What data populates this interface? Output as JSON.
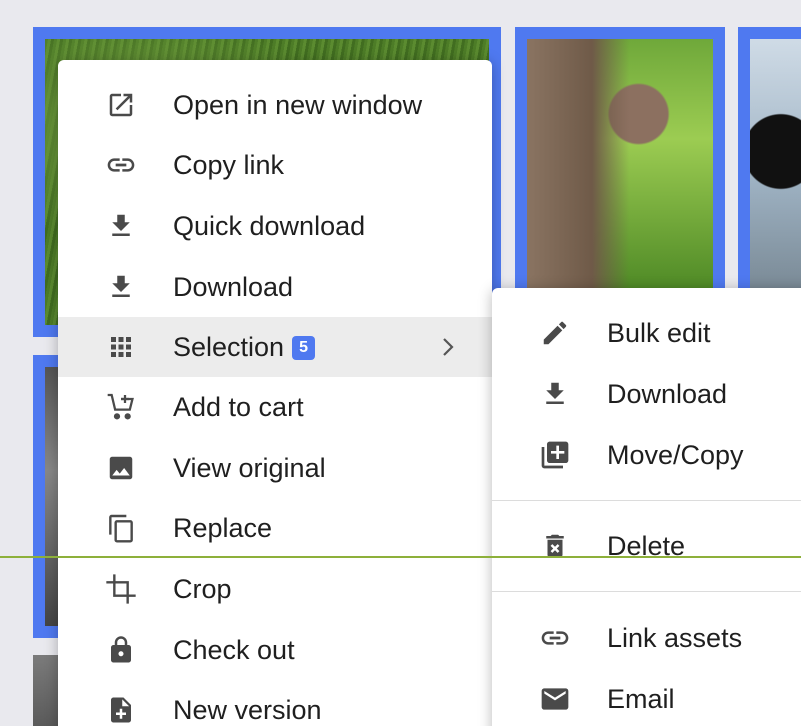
{
  "colors": {
    "selection_accent": "#4f79f0",
    "menu_bg": "#ffffff",
    "highlight_bg": "#ececec",
    "icon": "#4a4a4a",
    "guide_line": "#8db03a"
  },
  "context_menu": {
    "items": [
      {
        "label": "Open in new window",
        "icon": "open-in-new-icon"
      },
      {
        "label": "Copy link",
        "icon": "link-icon"
      },
      {
        "label": "Quick download",
        "icon": "download-icon"
      },
      {
        "label": "Download",
        "icon": "download-icon"
      },
      {
        "label": "Selection",
        "icon": "grid-icon",
        "badge": "5",
        "submenu": true,
        "highlighted": true
      },
      {
        "label": "Add to cart",
        "icon": "add-cart-icon"
      },
      {
        "label": "View original",
        "icon": "image-icon"
      },
      {
        "label": "Replace",
        "icon": "copy-icon"
      },
      {
        "label": "Crop",
        "icon": "crop-icon"
      },
      {
        "label": "Check out",
        "icon": "lock-icon"
      },
      {
        "label": "New version",
        "icon": "new-file-icon"
      }
    ]
  },
  "selection_submenu": {
    "items": [
      {
        "label": "Bulk edit",
        "icon": "pencil-icon"
      },
      {
        "label": "Download",
        "icon": "download-icon"
      },
      {
        "label": "Move/Copy",
        "icon": "library-add-icon"
      },
      {
        "label": "Delete",
        "icon": "trash-icon"
      },
      {
        "label": "Link assets",
        "icon": "link-icon"
      },
      {
        "label": "Email",
        "icon": "email-icon"
      }
    ]
  }
}
